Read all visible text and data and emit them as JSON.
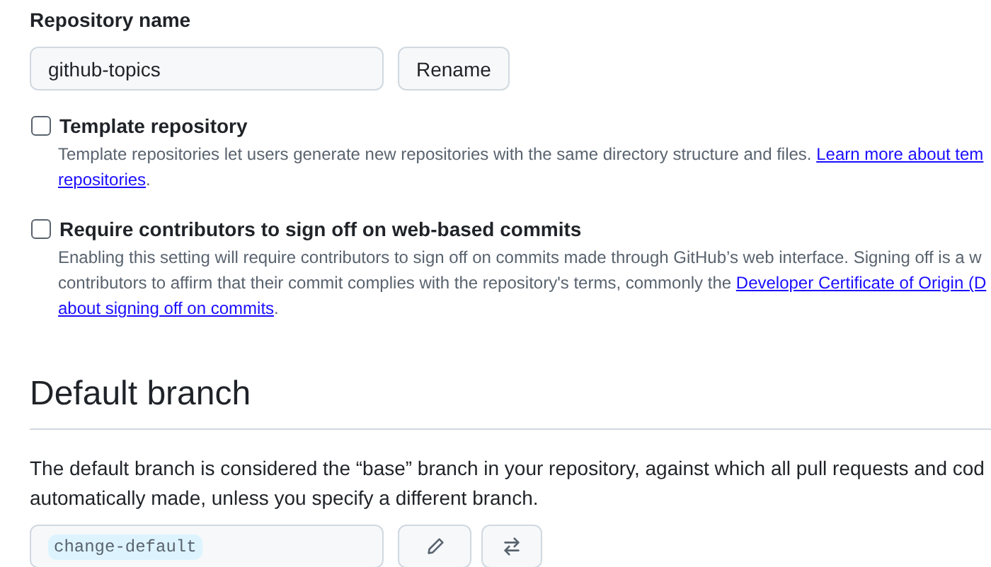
{
  "repository_name": {
    "label": "Repository name",
    "value": "github-topics",
    "button": "Rename"
  },
  "options": [
    {
      "label": "Template repository",
      "checked": false,
      "description_lines": [
        [
          {
            "kind": "text",
            "text": "Template repositories let users generate new repositories with the same directory structure and files. "
          },
          {
            "kind": "link",
            "text": "Learn more about tem"
          }
        ],
        [
          {
            "kind": "link",
            "text": "repositories"
          },
          {
            "kind": "text",
            "text": "."
          }
        ]
      ]
    },
    {
      "label": "Require contributors to sign off on web-based commits",
      "checked": false,
      "description_lines": [
        [
          {
            "kind": "text",
            "text": "Enabling this setting will require contributors to sign off on commits made through GitHub’s web interface. Signing off is a w"
          }
        ],
        [
          {
            "kind": "text",
            "text": "contributors to affirm that their commit complies with the repository's terms, commonly the "
          },
          {
            "kind": "link",
            "text": "Developer Certificate of Origin (D"
          }
        ],
        [
          {
            "kind": "link",
            "text": "about signing off on commits"
          },
          {
            "kind": "text",
            "text": "."
          }
        ]
      ]
    }
  ],
  "default_branch": {
    "heading": "Default branch",
    "description_lines": [
      "The default branch is considered the “base” branch in your repository, against which all pull requests and cod",
      "automatically made, unless you specify a different branch."
    ],
    "branch": "change-default"
  }
}
